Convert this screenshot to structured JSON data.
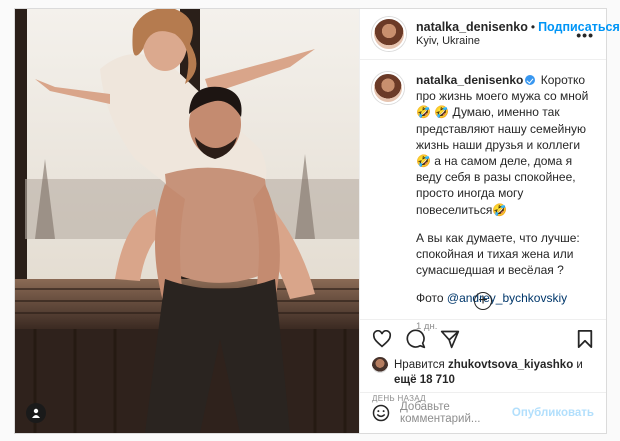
{
  "post": {
    "author": "natalka_denisenko",
    "follow_label": "Подписаться",
    "dot": "•",
    "location": "Kyiv, Ukraine",
    "more_label": "•••",
    "caption_first": "Коротко про жизнь моего мужа со мной 🤣 🤣 Думаю, именно так представляют нашу семейную жизнь наши друзья и коллеги 🤣 а на самом деле, дома я веду себя в разы спокойнее, просто иногда могу повеселиться🤣",
    "caption_second": "А вы как думаете, что лучше: спокойная и тихая жена или сумасшедшая и весёлая ?",
    "caption_photo_prefix": "Фото ",
    "caption_photo_mention": "@andrey_bychkovskiy",
    "caption_time": "1 дн.",
    "load_more": "+",
    "likes_prefix": "Нравится ",
    "likes_user": "zhukovtsova_kiyashko",
    "likes_mid": " и ",
    "likes_more": "ещё 18 710",
    "date": "ДЕНЬ НАЗАД",
    "comment_placeholder": "Добавьте комментарий...",
    "publish_label": "Опубликовать"
  },
  "icons": {
    "like": "heart-icon",
    "comment": "comment-icon",
    "share": "paper-plane-icon",
    "save": "bookmark-icon",
    "emoji": "smiley-icon",
    "tag": "user-tag-icon",
    "verified": "verified-badge-icon"
  },
  "colors": {
    "link": "#0095f6",
    "mention": "#00376b",
    "muted": "#8e8e8e",
    "publish_disabled": "#b2dffc",
    "verified": "#3897f0"
  }
}
